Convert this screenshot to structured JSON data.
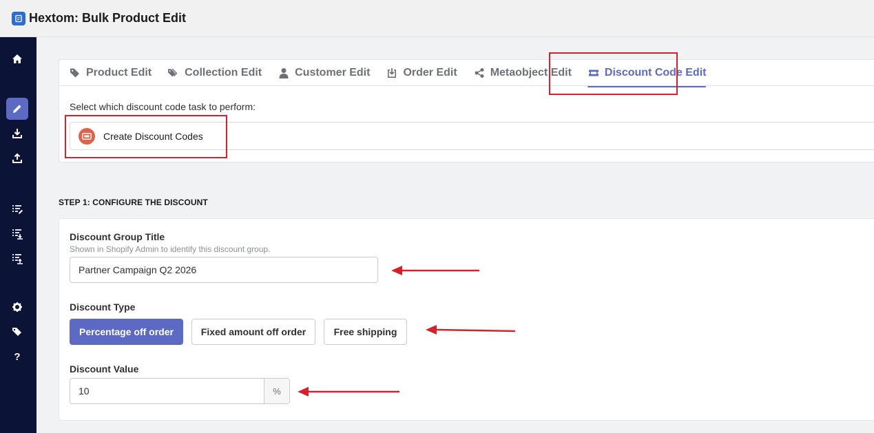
{
  "app": {
    "title": "Hextom: Bulk Product Edit"
  },
  "sidebar": {
    "items": [
      {
        "icon": "home-icon"
      },
      {
        "icon": "pencil-icon",
        "active": true
      },
      {
        "icon": "download-icon"
      },
      {
        "icon": "upload-icon"
      },
      {
        "icon": "list-edit-icon"
      },
      {
        "icon": "list-download-icon"
      },
      {
        "icon": "list-upload-icon"
      },
      {
        "icon": "gear-icon"
      },
      {
        "icon": "tags-icon"
      },
      {
        "icon": "help-icon",
        "glyph": "?"
      }
    ]
  },
  "tabs": [
    {
      "label": "Product Edit",
      "icon": "tag-icon"
    },
    {
      "label": "Collection Edit",
      "icon": "tags-icon"
    },
    {
      "label": "Customer Edit",
      "icon": "user-icon"
    },
    {
      "label": "Order Edit",
      "icon": "download-box-icon"
    },
    {
      "label": "Metaobject Edit",
      "icon": "share-icon"
    },
    {
      "label": "Discount Code Edit",
      "icon": "ticket-icon",
      "active": true
    }
  ],
  "task": {
    "prompt": "Select which discount code task to perform:",
    "option": "Create Discount Codes"
  },
  "step": {
    "title": "STEP 1: CONFIGURE THE DISCOUNT"
  },
  "form": {
    "group_title": {
      "label": "Discount Group Title",
      "help": "Shown in Shopify Admin to identify this discount group.",
      "value": "Partner Campaign Q2 2026"
    },
    "discount_type": {
      "label": "Discount Type",
      "options": [
        "Percentage off order",
        "Fixed amount off order",
        "Free shipping"
      ],
      "selected": "Percentage off order"
    },
    "discount_value": {
      "label": "Discount Value",
      "value": "10",
      "suffix": "%"
    }
  },
  "colors": {
    "accent": "#5c6ac4",
    "sidebar": "#0b1437",
    "annotation": "#d9202a",
    "task_icon": "#e0624a"
  }
}
